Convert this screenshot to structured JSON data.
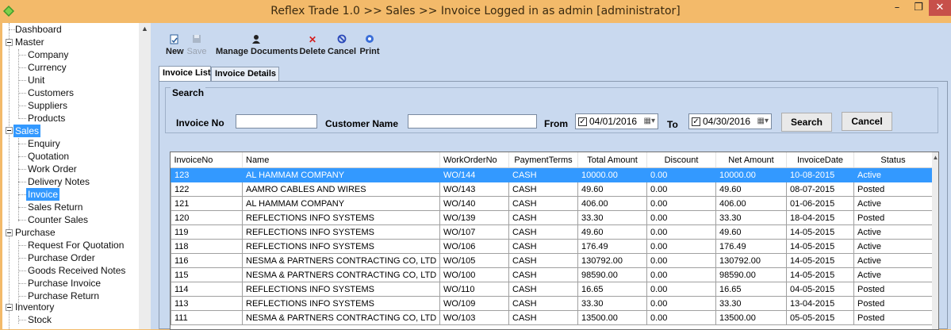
{
  "window": {
    "title": "Reflex Trade 1.0 >> Sales >> Invoice   Logged in as admin [administrator]",
    "icon": "green-diamond-icon",
    "minimize": "–",
    "maximize": "❐",
    "close": "✕"
  },
  "sidebar": {
    "items": [
      {
        "label": "Dashboard"
      },
      {
        "label": "Master"
      },
      {
        "label": "Company"
      },
      {
        "label": "Currency"
      },
      {
        "label": "Unit"
      },
      {
        "label": "Customers"
      },
      {
        "label": "Suppliers"
      },
      {
        "label": "Products"
      },
      {
        "label": "Sales"
      },
      {
        "label": "Enquiry"
      },
      {
        "label": "Quotation"
      },
      {
        "label": "Work Order"
      },
      {
        "label": "Delivery Notes"
      },
      {
        "label": "Invoice"
      },
      {
        "label": "Sales Return"
      },
      {
        "label": "Counter Sales"
      },
      {
        "label": "Purchase"
      },
      {
        "label": "Request For Quotation"
      },
      {
        "label": "Purchase Order"
      },
      {
        "label": "Goods Received Notes"
      },
      {
        "label": "Purchase Invoice"
      },
      {
        "label": "Purchase Return"
      },
      {
        "label": "Inventory"
      },
      {
        "label": "Stock"
      }
    ],
    "selected": "Invoice"
  },
  "toolbar": {
    "new_label": "New",
    "save_label": "Save",
    "manage_label": "Manage Documents",
    "delete_label": "Delete",
    "cancel_label": "Cancel",
    "print_label": "Print"
  },
  "tabs": {
    "list": "Invoice List",
    "details": "Invoice Details"
  },
  "search": {
    "legend": "Search",
    "invoice_no_label": "Invoice No",
    "invoice_no_value": "",
    "customer_label": "Customer Name",
    "customer_value": "",
    "from_label": "From",
    "from_date": "04/01/2016",
    "to_label": "To",
    "to_date": "04/30/2016",
    "search_button": "Search",
    "cancel_button": "Cancel"
  },
  "grid": {
    "columns": [
      "InvoiceNo",
      "Name",
      "WorkOrderNo",
      "PaymentTerms",
      "Total Amount",
      "Discount",
      "Net Amount",
      "InvoiceDate",
      "Status"
    ],
    "rows": [
      [
        "123",
        "AL HAMMAM COMPANY",
        "WO/144",
        "CASH",
        "10000.00",
        "0.00",
        "10000.00",
        "10-08-2015",
        "Active"
      ],
      [
        "122",
        "AAMRO CABLES AND WIRES",
        "WO/143",
        "CASH",
        "49.60",
        "0.00",
        "49.60",
        "08-07-2015",
        "Posted"
      ],
      [
        "121",
        "AL HAMMAM COMPANY",
        "WO/140",
        "CASH",
        "406.00",
        "0.00",
        "406.00",
        "01-06-2015",
        "Active"
      ],
      [
        "120",
        "REFLECTIONS INFO SYSTEMS",
        "WO/139",
        "CASH",
        "33.30",
        "0.00",
        "33.30",
        "18-04-2015",
        "Posted"
      ],
      [
        "119",
        "REFLECTIONS INFO SYSTEMS",
        "WO/107",
        "CASH",
        "49.60",
        "0.00",
        "49.60",
        "14-05-2015",
        "Active"
      ],
      [
        "118",
        "REFLECTIONS INFO SYSTEMS",
        "WO/106",
        "CASH",
        "176.49",
        "0.00",
        "176.49",
        "14-05-2015",
        "Active"
      ],
      [
        "116",
        "NESMA & PARTNERS CONTRACTING CO, LTD",
        "WO/105",
        "CASH",
        "130792.00",
        "0.00",
        "130792.00",
        "14-05-2015",
        "Active"
      ],
      [
        "115",
        "NESMA & PARTNERS CONTRACTING CO, LTD",
        "WO/100",
        "CASH",
        "98590.00",
        "0.00",
        "98590.00",
        "14-05-2015",
        "Active"
      ],
      [
        "114",
        "REFLECTIONS INFO SYSTEMS",
        "WO/110",
        "CASH",
        "16.65",
        "0.00",
        "16.65",
        "04-05-2015",
        "Posted"
      ],
      [
        "113",
        "REFLECTIONS INFO SYSTEMS",
        "WO/109",
        "CASH",
        "33.30",
        "0.00",
        "33.30",
        "13-04-2015",
        "Posted"
      ],
      [
        "111",
        "NESMA & PARTNERS CONTRACTING CO, LTD",
        "WO/103",
        "CASH",
        "13500.00",
        "0.00",
        "13500.00",
        "05-05-2015",
        "Posted"
      ]
    ],
    "selected_row": 0
  },
  "colors": {
    "title_bar": "#f3ba6a",
    "close_button": "#c7504a",
    "content_bg": "#c9d9ef",
    "selection": "#3399ff"
  }
}
